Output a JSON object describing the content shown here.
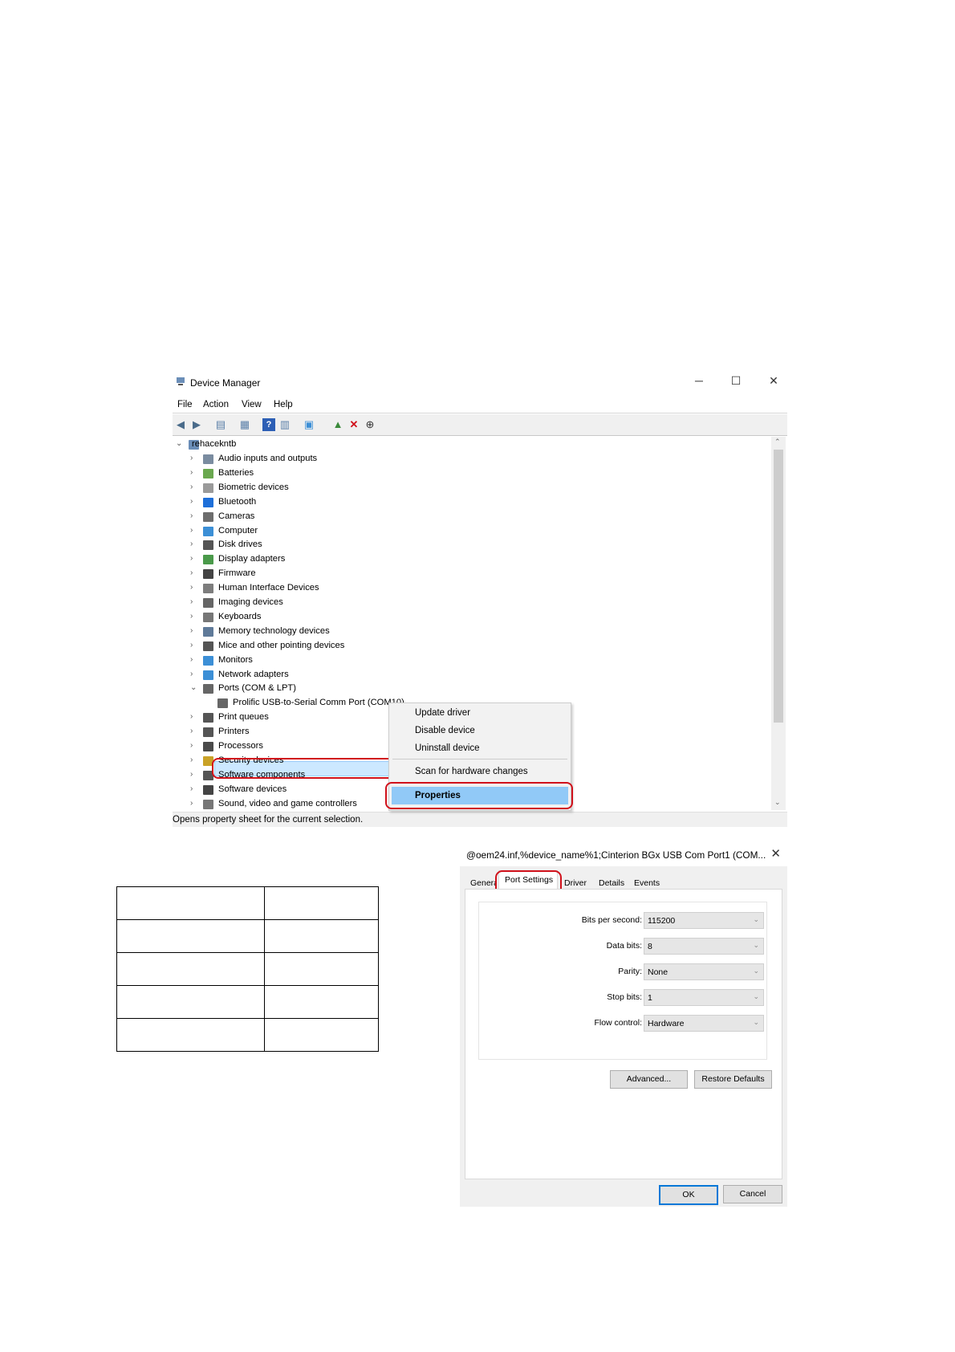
{
  "device_manager": {
    "title": "Device Manager",
    "window_buttons": {
      "minimize": "─",
      "maximize": "☐",
      "close": "✕"
    },
    "menu": [
      "File",
      "Action",
      "View",
      "Help"
    ],
    "root": "rehaceknt­b",
    "tree": [
      {
        "label": "Audio inputs and outputs",
        "icon": "speaker-icon",
        "color": "#7a8ca0"
      },
      {
        "label": "Batteries",
        "icon": "battery-icon",
        "color": "#6aa84f"
      },
      {
        "label": "Biometric devices",
        "icon": "fingerprint-icon",
        "color": "#9a9a9a"
      },
      {
        "label": "Bluetooth",
        "icon": "bluetooth-icon",
        "color": "#1e6fd9"
      },
      {
        "label": "Cameras",
        "icon": "camera-icon",
        "color": "#6d6d6d"
      },
      {
        "label": "Computer",
        "icon": "computer-icon",
        "color": "#3c8fd6"
      },
      {
        "label": "Disk drives",
        "icon": "disk-icon",
        "color": "#555555"
      },
      {
        "label": "Display adapters",
        "icon": "display-adapter-icon",
        "color": "#4a9a4a"
      },
      {
        "label": "Firmware",
        "icon": "firmware-icon",
        "color": "#444444"
      },
      {
        "label": "Human Interface Devices",
        "icon": "hid-icon",
        "color": "#7d7d7d"
      },
      {
        "label": "Imaging devices",
        "icon": "imaging-icon",
        "color": "#666666"
      },
      {
        "label": "Keyboards",
        "icon": "keyboard-icon",
        "color": "#777777"
      },
      {
        "label": "Memory technology devices",
        "icon": "memory-icon",
        "color": "#5f7a99"
      },
      {
        "label": "Mice and other pointing devices",
        "icon": "mouse-icon",
        "color": "#555555"
      },
      {
        "label": "Monitors",
        "icon": "monitor-icon",
        "color": "#3c8fd6"
      },
      {
        "label": "Network adapters",
        "icon": "network-icon",
        "color": "#3c8fd6"
      },
      {
        "label": "Ports (COM & LPT)",
        "icon": "port-icon",
        "color": "#666666",
        "expanded": true
      },
      {
        "label": "Prolific USB-to-Serial Comm Port (COM10)",
        "icon": "port-icon",
        "color": "#666666",
        "child": true,
        "selected": true
      },
      {
        "label": "Print queues",
        "icon": "print-queue-icon",
        "color": "#555555"
      },
      {
        "label": "Printers",
        "icon": "printer-icon",
        "color": "#555555"
      },
      {
        "label": "Processors",
        "icon": "processor-icon",
        "color": "#4a4a4a"
      },
      {
        "label": "Security devices",
        "icon": "security-icon",
        "color": "#c9a227"
      },
      {
        "label": "Software components",
        "icon": "software-components-icon",
        "color": "#555555"
      },
      {
        "label": "Software devices",
        "icon": "software-devices-icon",
        "color": "#444444"
      },
      {
        "label": "Sound, video and game controllers",
        "icon": "sound-icon",
        "color": "#777777"
      }
    ],
    "context_menu": [
      "Update driver",
      "Disable device",
      "Uninstall device",
      "Scan for hardware changes",
      "Properties"
    ],
    "status": "Opens property sheet for the current selection.",
    "highlight_color": "#d0111b",
    "menu_highlight_color": "#91c9f7"
  },
  "properties_dialog": {
    "title": "@oem24.inf,%device_name%1;Cinterion BGx USB Com Port1 (COM...",
    "close": "✕",
    "tabs": [
      "General",
      "Port Settings",
      "Driver",
      "Details",
      "Events"
    ],
    "active_tab": "Port Settings",
    "fields": [
      {
        "label": "Bits per second:",
        "value": "115200"
      },
      {
        "label": "Data bits:",
        "value": "8"
      },
      {
        "label": "Parity:",
        "value": "None"
      },
      {
        "label": "Stop bits:",
        "value": "1"
      },
      {
        "label": "Flow control:",
        "value": "Hardware"
      }
    ],
    "advanced_button": "Advanced...",
    "restore_button": "Restore Defaults",
    "ok_button": "OK",
    "cancel_button": "Cancel"
  },
  "table": {
    "rows": 5,
    "cols": 2
  }
}
